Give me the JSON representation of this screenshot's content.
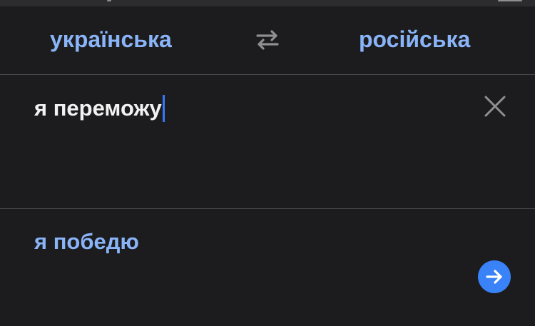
{
  "languages": {
    "source": "українська",
    "target": "російська"
  },
  "input": {
    "text": "я переможу"
  },
  "output": {
    "text": "я победю"
  },
  "icons": {
    "swap": "swap-arrows-icon",
    "clear": "close-icon",
    "go": "arrow-right-icon"
  },
  "colors": {
    "background": "#1c1c1e",
    "accent": "#8ab4f8",
    "button": "#3a82f7",
    "caret": "#3478f6",
    "divider": "#4a4a4e"
  }
}
